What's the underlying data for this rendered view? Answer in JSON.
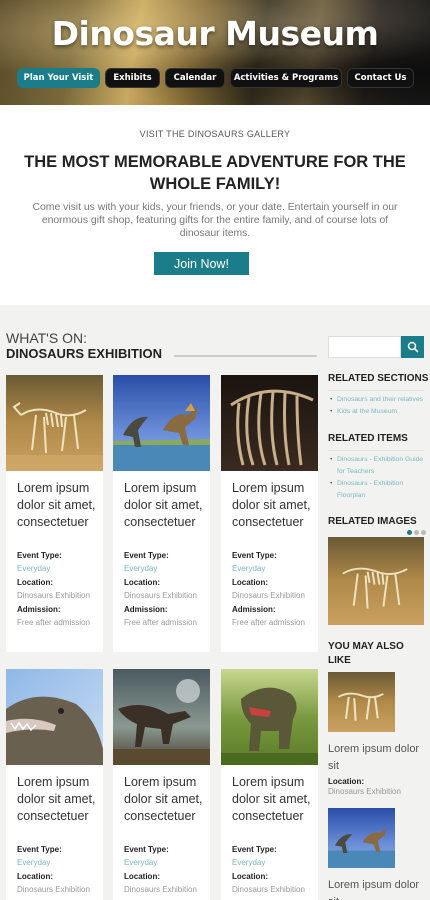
{
  "header": {
    "title": "Dinosaur Museum",
    "nav": [
      {
        "label": "Plan Your Visit",
        "active": true
      },
      {
        "label": "Exhibits",
        "active": false
      },
      {
        "label": "Calendar",
        "active": false
      },
      {
        "label": "Activities & Programs",
        "active": false
      },
      {
        "label": "Contact Us",
        "active": false
      }
    ]
  },
  "intro": {
    "kicker": "VISIT THE DINOSAURS GALLERY",
    "heading": "THE MOST MEMORABLE ADVENTURE FOR THE WHOLE FAMILY!",
    "text": "Come visit us with your kids, your friends, or your date. Entertain yourself in our enormous gift shop, featuring gifts for the entire family, and of course lots of dinosaur items.",
    "join_label": "Join Now!"
  },
  "whats_on": {
    "kicker": "WHAT'S ON:",
    "title": "DINOSAURS EXHIBITION",
    "labels": {
      "event_type": "Event Type:",
      "location": "Location:",
      "admission": "Admission:"
    },
    "cards": [
      {
        "title": "Lorem ipsum dolor sit amet, consectetuer",
        "event_type": "Everyday",
        "location": "Dinosaurs Exhibition",
        "admission": "Free after admission",
        "image": "skeleton"
      },
      {
        "title": "Lorem ipsum dolor sit amet, consectetuer",
        "event_type": "Everyday",
        "location": "Dinosaurs Exhibition",
        "admission": "Free after admission",
        "image": "water-dinos"
      },
      {
        "title": "Lorem ipsum dolor sit amet, consectetuer",
        "event_type": "Everyday",
        "location": "Dinosaurs Exhibition",
        "admission": "Free after admission",
        "image": "ribcage"
      },
      {
        "title": "Lorem ipsum dolor sit amet, consectetuer",
        "event_type": "Everyday",
        "location": "Dinosaurs Exhibition",
        "image": "dino-head"
      },
      {
        "title": "Lorem ipsum dolor sit amet, consectetuer",
        "event_type": "Everyday",
        "location": "Dinosaurs Exhibition",
        "image": "trex-sky"
      },
      {
        "title": "Lorem ipsum dolor sit amet, consectetuer",
        "event_type": "Everyday",
        "location": "Dinosaurs Exhibition",
        "image": "trex-forest"
      }
    ]
  },
  "sidebar": {
    "related_sections": {
      "title": "RELATED SECTIONS",
      "links": [
        "Dinosaurs and their relatives",
        "Kids at the Museum"
      ]
    },
    "related_items": {
      "title": "RELATED ITEMS",
      "links": [
        "Dinosaurs - Exhibition Guide for Teachers",
        "Dinosaurs - Exhibition Floorplan"
      ]
    },
    "related_images": {
      "title": "RELATED IMAGES",
      "image": "skeleton"
    },
    "also_like": {
      "title": "YOU MAY ALSO LIKE",
      "items": [
        {
          "caption": "Lorem ipsum dolor sit",
          "location_label": "Location:",
          "location": "Dinosaurs Exhibition",
          "image": "skeleton"
        },
        {
          "caption": "Lorem ipsum dolor sit",
          "image": "water-dinos"
        }
      ]
    }
  },
  "colors": {
    "accent": "#1b7d8a",
    "link": "#7ab8c0"
  }
}
